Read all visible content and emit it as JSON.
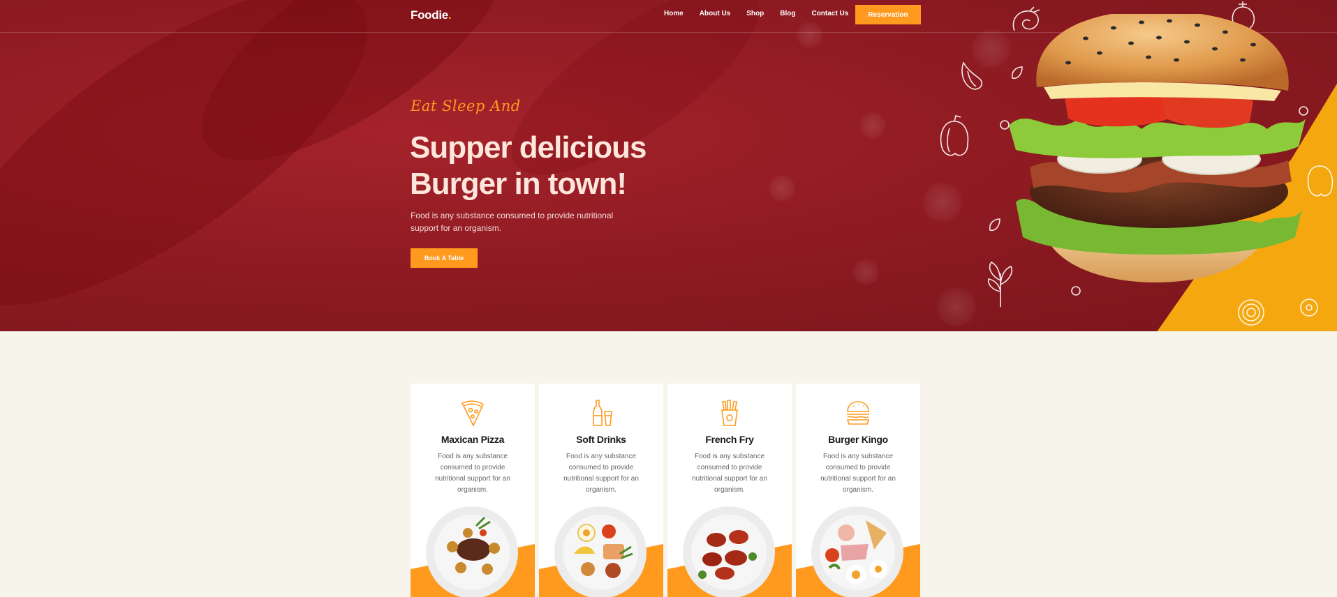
{
  "brand": {
    "name": "Foodie",
    "dot": ".",
    "accent": "#ff9a1f",
    "hero_bg": "#8e1a22"
  },
  "nav": {
    "items": [
      "Home",
      "About Us",
      "Shop",
      "Blog",
      "Contact Us"
    ],
    "cta": "Reservation"
  },
  "hero": {
    "tagline": "Eat Sleep And",
    "title_line1": "Supper delicious",
    "title_line2": "Burger in town!",
    "text": "Food is any substance consumed to provide nutritional support for an organism.",
    "button": "Book A Table"
  },
  "cards": [
    {
      "icon": "pizza-slice-icon",
      "title": "Maxican Pizza",
      "desc": "Food is any substance consumed to provide nutritional support for an organism."
    },
    {
      "icon": "soft-drinks-icon",
      "title": "Soft Drinks",
      "desc": "Food is any substance consumed to provide nutritional support for an organism."
    },
    {
      "icon": "french-fries-icon",
      "title": "French Fry",
      "desc": "Food is any substance consumed to provide nutritional support for an organism."
    },
    {
      "icon": "burger-icon",
      "title": "Burger Kingo",
      "desc": "Food is any substance consumed to provide nutritional support for an organism."
    }
  ]
}
